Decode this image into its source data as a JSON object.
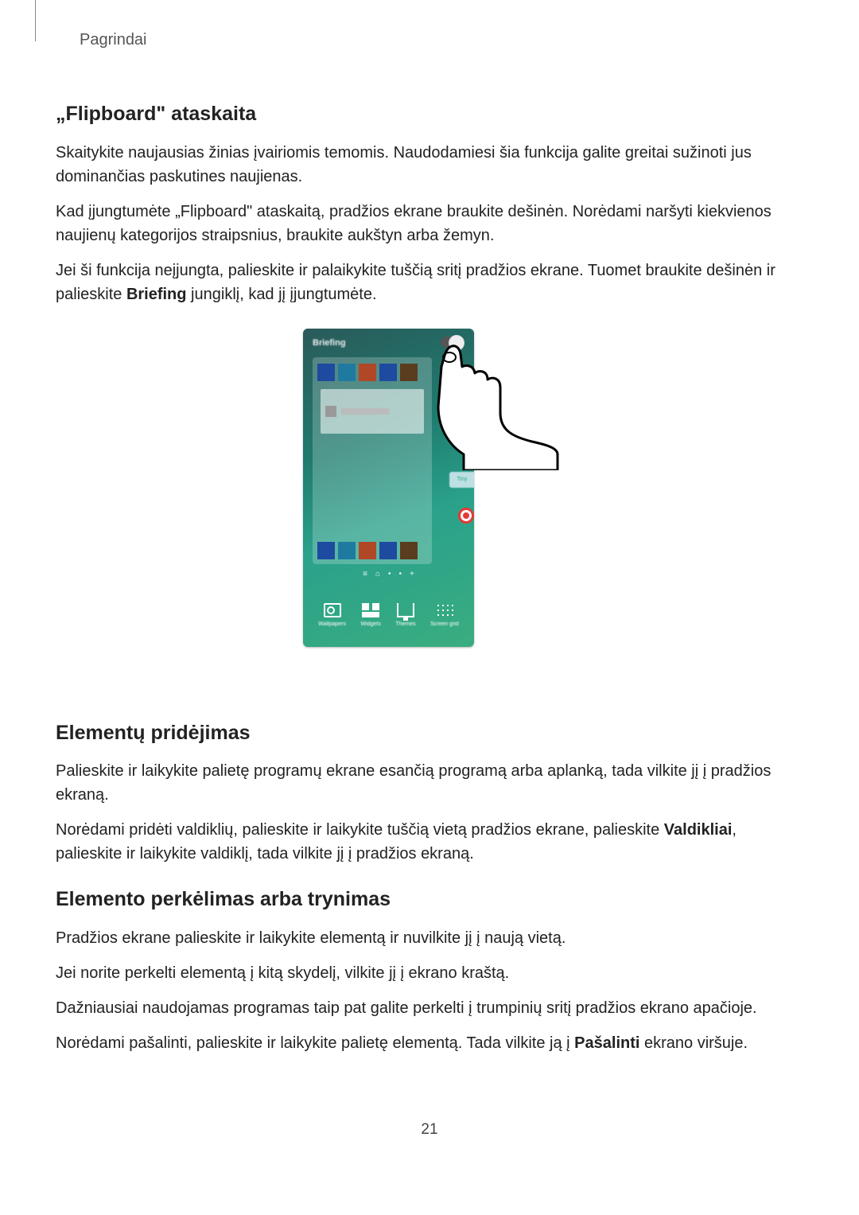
{
  "section_header": "Pagrindai",
  "s1": {
    "title": "„Flipboard\" ataskaita",
    "p1": "Skaitykite naujausias žinias įvairiomis temomis. Naudodamiesi šia funkcija galite greitai sužinoti jus dominančias paskutines naujienas.",
    "p2": "Kad įjungtumėte „Flipboard\" ataskaitą, pradžios ekrane braukite dešinėn. Norėdami naršyti kiekvienos naujienų kategorijos straipsnius, braukite aukštyn arba žemyn.",
    "p3a": "Jei ši funkcija neįjungta, palieskite ir palaikykite tuščią sritį pradžios ekrane. Tuomet braukite dešinėn ir palieskite ",
    "p3_bold": "Briefing",
    "p3b": " jungiklį, kad jį įjungtumėte."
  },
  "figure": {
    "briefing_label": "Briefing",
    "bottom_icons": [
      "Wallpapers",
      "Widgets",
      "Themes",
      "Screen grid"
    ]
  },
  "s2": {
    "title": "Elementų pridėjimas",
    "p1": "Palieskite ir laikykite palietę programų ekrane esančią programą arba aplanką, tada vilkite jį į pradžios ekraną.",
    "p2a": "Norėdami pridėti valdiklių, palieskite ir laikykite tuščią vietą pradžios ekrane, palieskite ",
    "p2_bold": "Valdikliai",
    "p2b": ", palieskite ir laikykite valdiklį, tada vilkite jį į pradžios ekraną."
  },
  "s3": {
    "title": "Elemento perkėlimas arba trynimas",
    "p1": "Pradžios ekrane palieskite ir laikykite elementą ir nuvilkite jį į naują vietą.",
    "p2": "Jei norite perkelti elementą į kitą skydelį, vilkite jį į ekrano kraštą.",
    "p3": "Dažniausiai naudojamas programas taip pat galite perkelti į trumpinių sritį pradžios ekrano apačioje.",
    "p4a": "Norėdami pašalinti, palieskite ir laikykite palietę elementą. Tada vilkite ją į ",
    "p4_bold": "Pašalinti",
    "p4b": " ekrano viršuje."
  },
  "page_number": "21"
}
